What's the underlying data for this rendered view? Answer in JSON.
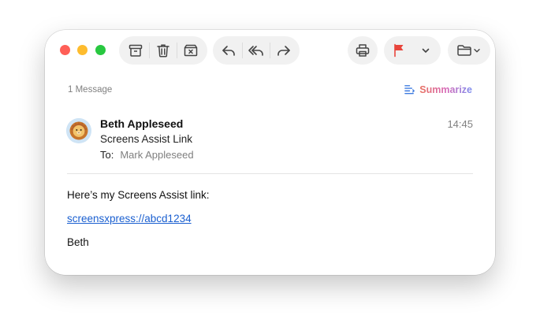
{
  "toolbar": {
    "archive": {
      "icon": "archive-icon"
    },
    "trash": {
      "icon": "trash-icon"
    },
    "junk": {
      "icon": "junk-icon"
    },
    "reply": {
      "icon": "reply-icon"
    },
    "reply_all": {
      "icon": "reply-all-icon"
    },
    "forward": {
      "icon": "forward-icon"
    },
    "print": {
      "icon": "printer-icon"
    },
    "flag": {
      "icon": "flag-icon",
      "color": "#e8453c"
    },
    "flag_menu": {
      "icon": "chevron-down-icon"
    },
    "move": {
      "icon": "folder-icon"
    }
  },
  "thread": {
    "count_label": "1 Message",
    "summarize_label": "Summarize"
  },
  "message": {
    "sender": "Beth Appleseed",
    "time": "14:45",
    "subject": "Screens Assist Link",
    "to_label": "To:",
    "to_name": "Mark Appleseed",
    "body": {
      "line1": "Here’s my Screens Assist link:",
      "link": "screensxpress://abcd1234",
      "signature": "Beth"
    }
  },
  "colors": {
    "close": "#ff5f57",
    "minimize": "#febc2e",
    "zoom": "#28c840",
    "link": "#1a5fd0"
  }
}
